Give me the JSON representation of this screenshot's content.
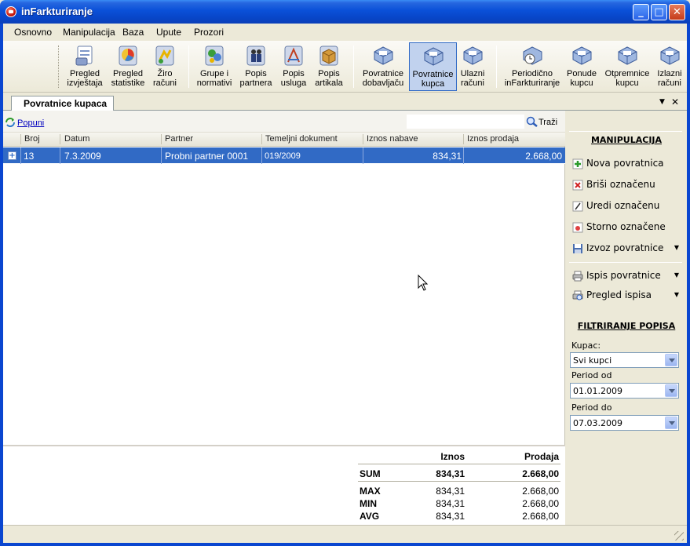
{
  "window": {
    "title": "inFarkturiranje",
    "min": "_",
    "max": "□",
    "close": "✕"
  },
  "menu": [
    "Osnovno",
    "Manipulacija",
    "Baza",
    "Upute",
    "Prozori"
  ],
  "toolbar": [
    {
      "l1": "Pregled",
      "l2": "izvještaja",
      "icon": "report-icon"
    },
    {
      "l1": "Pregled",
      "l2": "statistike",
      "icon": "statistics-icon"
    },
    {
      "l1": "Žiro",
      "l2": "računi",
      "icon": "bank-account-icon"
    },
    {
      "l1": "Grupe i",
      "l2": "normativi",
      "icon": "groups-icon"
    },
    {
      "l1": "Popis",
      "l2": "partnera",
      "icon": "partners-icon"
    },
    {
      "l1": "Popis",
      "l2": "usluga",
      "icon": "services-icon"
    },
    {
      "l1": "Popis",
      "l2": "artikala",
      "icon": "articles-icon"
    },
    {
      "l1": "Povratnice",
      "l2": "dobavljaču",
      "icon": "supplier-return-icon"
    },
    {
      "l1": "Povratnice",
      "l2": "kupca",
      "icon": "customer-return-icon"
    },
    {
      "l1": "Ulazni",
      "l2": "računi",
      "icon": "incoming-invoice-icon"
    },
    {
      "l1": "Periodično",
      "l2": "inFarkturiranje",
      "icon": "periodic-icon"
    },
    {
      "l1": "Ponude",
      "l2": "kupcu",
      "icon": "offers-icon"
    },
    {
      "l1": "Otpremnice",
      "l2": "kupcu",
      "icon": "delivery-note-icon"
    },
    {
      "l1": "Izlazni",
      "l2": "računi",
      "icon": "outgoing-invoice-icon"
    }
  ],
  "tab": {
    "label": "Povratnice kupaca",
    "pin": "▼",
    "close": "✕"
  },
  "pane": {
    "popuni": "Popuni",
    "search_placeholder": "",
    "trazi": "Traži"
  },
  "grid": {
    "columns": [
      "Broj",
      "Datum",
      "Partner",
      "Temeljni dokument",
      "Iznos nabave",
      "Iznos prodaja"
    ],
    "rows": [
      {
        "expander": "+",
        "broj": "13",
        "datum": "7.3.2009",
        "partner": "Probni partner 0001",
        "dokument": "019/2009",
        "nabava": "834,31",
        "prodaja": "2.668,00"
      }
    ]
  },
  "summary": {
    "col1": "Iznos",
    "col2": "Prodaja",
    "rows": [
      {
        "label": "SUM",
        "iznos": "834,31",
        "prodaja": "2.668,00"
      },
      {
        "label": "MAX",
        "iznos": "834,31",
        "prodaja": "2.668,00"
      },
      {
        "label": "MIN",
        "iznos": "834,31",
        "prodaja": "2.668,00"
      },
      {
        "label": "AVG",
        "iznos": "834,31",
        "prodaja": "2.668,00"
      }
    ]
  },
  "panel": {
    "manip_title": "MANIPULACIJA",
    "actions": [
      "Nova povratnica",
      "Briši označenu",
      "Uredi označenu",
      "Storno označene",
      "Izvoz povratnice",
      "Ispis povratnice",
      "Pregled ispisa"
    ],
    "dropdown_arrow": "▼",
    "filter_title": "FILTRIRANJE POPISA",
    "kupac_label": "Kupac:",
    "kupac_value": "Svi kupci",
    "od_label": "Period od",
    "od_value": "01.01.2009",
    "do_label": "Period do",
    "do_value": "07.03.2009"
  },
  "colors": {
    "selection": "#316ac5",
    "titlebar": "#0a50d8",
    "close": "#c53b1a"
  }
}
